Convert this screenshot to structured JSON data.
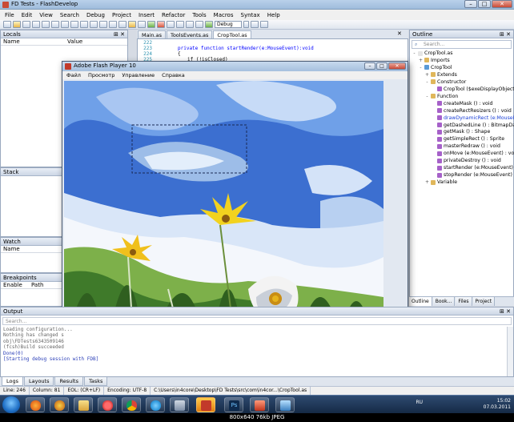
{
  "window": {
    "title": "FD Tests - FlashDevelop"
  },
  "menu": [
    "File",
    "Edit",
    "View",
    "Search",
    "Debug",
    "Project",
    "Insert",
    "Refactor",
    "Tools",
    "Macros",
    "Syntax",
    "Help"
  ],
  "toolbar": {
    "config": "Debug"
  },
  "locals": {
    "title": "Locals",
    "col_name": "Name",
    "col_value": "Value"
  },
  "stack": {
    "title": "Stack"
  },
  "watch": {
    "title": "Watch",
    "col_name": "Name"
  },
  "breakpoints": {
    "title": "Breakpoints",
    "col_enable": "Enable",
    "col_path": "Path"
  },
  "editor": {
    "tabs": [
      "Main.as",
      "ToolsEvents.as",
      "CropTool.as"
    ],
    "active_tab": 2,
    "lines": [
      {
        "no": "222",
        "code": ""
      },
      {
        "no": "223",
        "code": "private function startRender(e:MouseEvent):void"
      },
      {
        "no": "224",
        "code": "{"
      },
      {
        "no": "225",
        "code": "if (!isClosed) "
      }
    ]
  },
  "flash": {
    "title": "Adobe Flash Player 10",
    "menu": [
      "Файл",
      "Просмотр",
      "Управление",
      "Справка"
    ]
  },
  "outline": {
    "title": "Outline",
    "search_placeholder": "Search...",
    "nodes": [
      {
        "label": "CropTool.as",
        "depth": 0,
        "exp": "-",
        "color": "#e5e5e5"
      },
      {
        "label": "Imports",
        "depth": 1,
        "exp": "+",
        "color": "#e0b75b"
      },
      {
        "label": "CropTool",
        "depth": 1,
        "exp": "-",
        "color": "#5b9ad6"
      },
      {
        "label": "Extends",
        "depth": 2,
        "exp": "+",
        "color": "#e0b75b"
      },
      {
        "label": "Constructor",
        "depth": 2,
        "exp": "-",
        "color": "#e0b75b"
      },
      {
        "label": "CropTool ($exeDisplayObjectCo",
        "depth": 3,
        "exp": "",
        "color": "#a661c9"
      },
      {
        "label": "Function",
        "depth": 2,
        "exp": "-",
        "color": "#e0b75b"
      },
      {
        "label": "createMask () : void",
        "depth": 3,
        "exp": "",
        "color": "#a661c9"
      },
      {
        "label": "createRectResizers () : void",
        "depth": 3,
        "exp": "",
        "color": "#a661c9"
      },
      {
        "label": "drawDynamicRect (e:MouseEvent",
        "depth": 3,
        "exp": "",
        "color": "#a661c9",
        "highlight": true
      },
      {
        "label": "getDashedLine () : BitmapDate",
        "depth": 3,
        "exp": "",
        "color": "#a661c9"
      },
      {
        "label": "getMask () : Shape",
        "depth": 3,
        "exp": "",
        "color": "#a661c9"
      },
      {
        "label": "getSimpleRect () : Sprite",
        "depth": 3,
        "exp": "",
        "color": "#a661c9"
      },
      {
        "label": "masterRedraw () : void",
        "depth": 3,
        "exp": "",
        "color": "#a661c9"
      },
      {
        "label": "onMove (e:MouseEvent) : void",
        "depth": 3,
        "exp": "",
        "color": "#a661c9"
      },
      {
        "label": "privateDestroy () : void",
        "depth": 3,
        "exp": "",
        "color": "#a661c9"
      },
      {
        "label": "startRender (e:MouseEvent) : void",
        "depth": 3,
        "exp": "",
        "color": "#a661c9"
      },
      {
        "label": "stopRender (e:MouseEvent) : void",
        "depth": 3,
        "exp": "",
        "color": "#a661c9"
      },
      {
        "label": "Variable",
        "depth": 2,
        "exp": "+",
        "color": "#e0b75b"
      }
    ],
    "tabs": [
      "Outline",
      "Book...",
      "Files",
      "Project"
    ]
  },
  "output": {
    "title": "Output",
    "search_placeholder": "Search...",
    "lines": [
      "Loading configuration...",
      "Nothing has changed s",
      "obj\\FDTests6343509146",
      "(fcsh)Build succeeded",
      "Done(0)",
      "[Starting debug session with FDB]"
    ]
  },
  "bottom_tabs": [
    "Logs",
    "Layouts",
    "Results",
    "Tasks"
  ],
  "status": {
    "line": "Line: 246",
    "column": "Column: 81",
    "eol": "EOL: (CR+LF)",
    "encoding": "Encoding: UTF-8",
    "path": "C:\\Users\\in4core\\Desktop\\FD Tests\\src\\com\\in4cor...\\CropTool.as"
  },
  "taskbar": {
    "lang": "RU",
    "time": "15:02",
    "date": "07.03.2011",
    "ps_label": "Ps"
  },
  "watermark": "800x640  76kb  JPEG"
}
